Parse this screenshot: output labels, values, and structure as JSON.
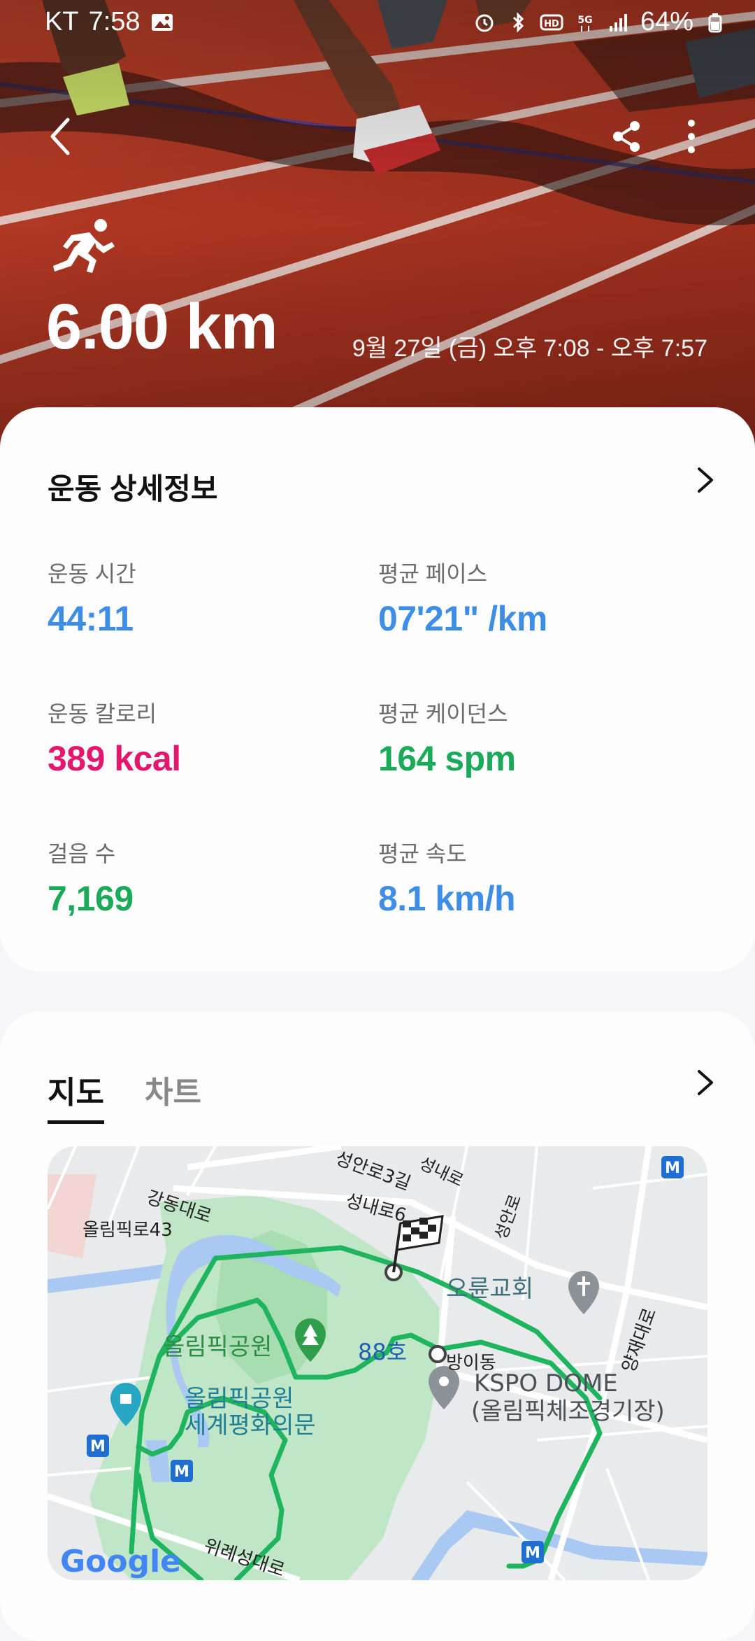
{
  "status": {
    "carrier": "KT",
    "time": "7:58",
    "battery": "64%"
  },
  "hero": {
    "back_icon": "back-arrow-icon",
    "share_icon": "share-icon",
    "more_icon": "more-vertical-icon",
    "activity_icon": "running-icon",
    "distance": "6.00 km",
    "datetime": "9월 27일 (금) 오후 7:08 - 오후 7:57"
  },
  "details": {
    "title": "운동 상세정보",
    "metrics": [
      {
        "label": "운동 시간",
        "value": "44:11",
        "color": "#3f8ee6"
      },
      {
        "label": "평균 페이스",
        "value": "07'21\" /km",
        "color": "#3f8ee6"
      },
      {
        "label": "운동 칼로리",
        "value": "389 kcal",
        "color": "#e3176d"
      },
      {
        "label": "평균 케이던스",
        "value": "164 spm",
        "color": "#1aaa5a"
      },
      {
        "label": "걸음 수",
        "value": "7,169",
        "color": "#1aaa5a"
      },
      {
        "label": "평균 속도",
        "value": "8.1 km/h",
        "color": "#3f8ee6"
      }
    ]
  },
  "map_section": {
    "tabs": [
      "지도",
      "차트"
    ],
    "active_tab": "지도",
    "labels": {
      "road1": "성안로3길",
      "road2": "성내로",
      "road3": "성내로6",
      "road4": "강동대로",
      "road5": "올림픽로43",
      "road6": "성안로",
      "road7": "양재대로",
      "road8": "위례성대로",
      "church": "오륜교회",
      "park": "올림픽공원",
      "gate1": "올림픽공원",
      "gate2": "세계평화의문",
      "lake": "88호",
      "dome1": "KSPO DOME",
      "dome2": "(올림픽체조경기장)",
      "district": "방이동",
      "brand": "Google"
    }
  }
}
